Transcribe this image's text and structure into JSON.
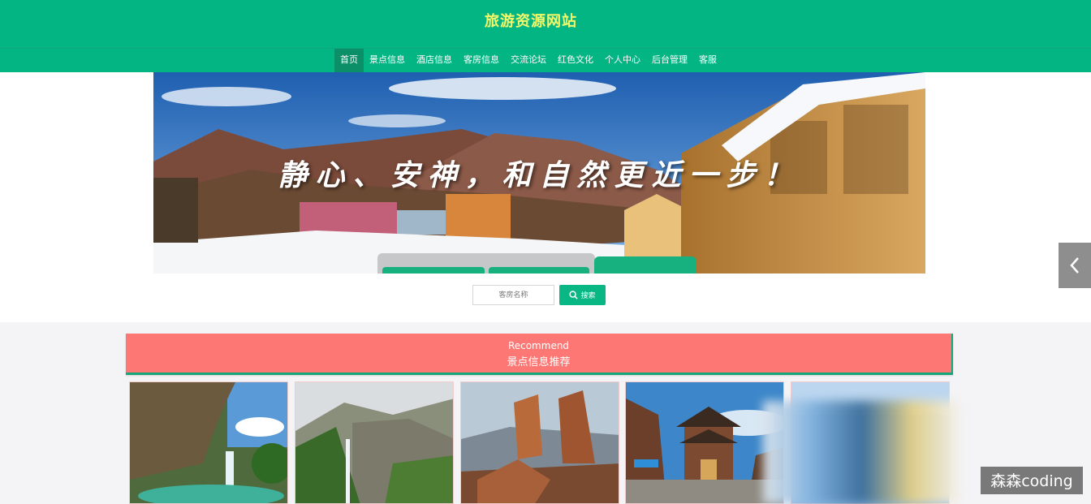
{
  "header": {
    "site_title": "旅游资源网站"
  },
  "nav": {
    "items": [
      {
        "label": "首页",
        "active": true
      },
      {
        "label": "景点信息",
        "active": false
      },
      {
        "label": "酒店信息",
        "active": false
      },
      {
        "label": "客房信息",
        "active": false
      },
      {
        "label": "交流论坛",
        "active": false
      },
      {
        "label": "红色文化",
        "active": false
      },
      {
        "label": "个人中心",
        "active": false
      },
      {
        "label": "后台管理",
        "active": false
      },
      {
        "label": "客服",
        "active": false
      }
    ]
  },
  "banner": {
    "slogan": "静心、安神，和自然更近一步！"
  },
  "search": {
    "placeholder": "客房名称",
    "button_label": "搜索"
  },
  "recommend": {
    "title_en": "Recommend",
    "title_cn": "景点信息推荐"
  },
  "cards": [
    {
      "image": "cave-waterfall-lake"
    },
    {
      "image": "mountain-waterfall-cliff"
    },
    {
      "image": "red-rock-pillars"
    },
    {
      "image": "ancient-town-gate-tower"
    },
    {
      "image": "blurred-sky-scene"
    }
  ],
  "watermark": "森森coding",
  "colors": {
    "brand_green": "#04b584",
    "title_yellow": "#f4f96a",
    "recommend_red": "#fd7874"
  }
}
